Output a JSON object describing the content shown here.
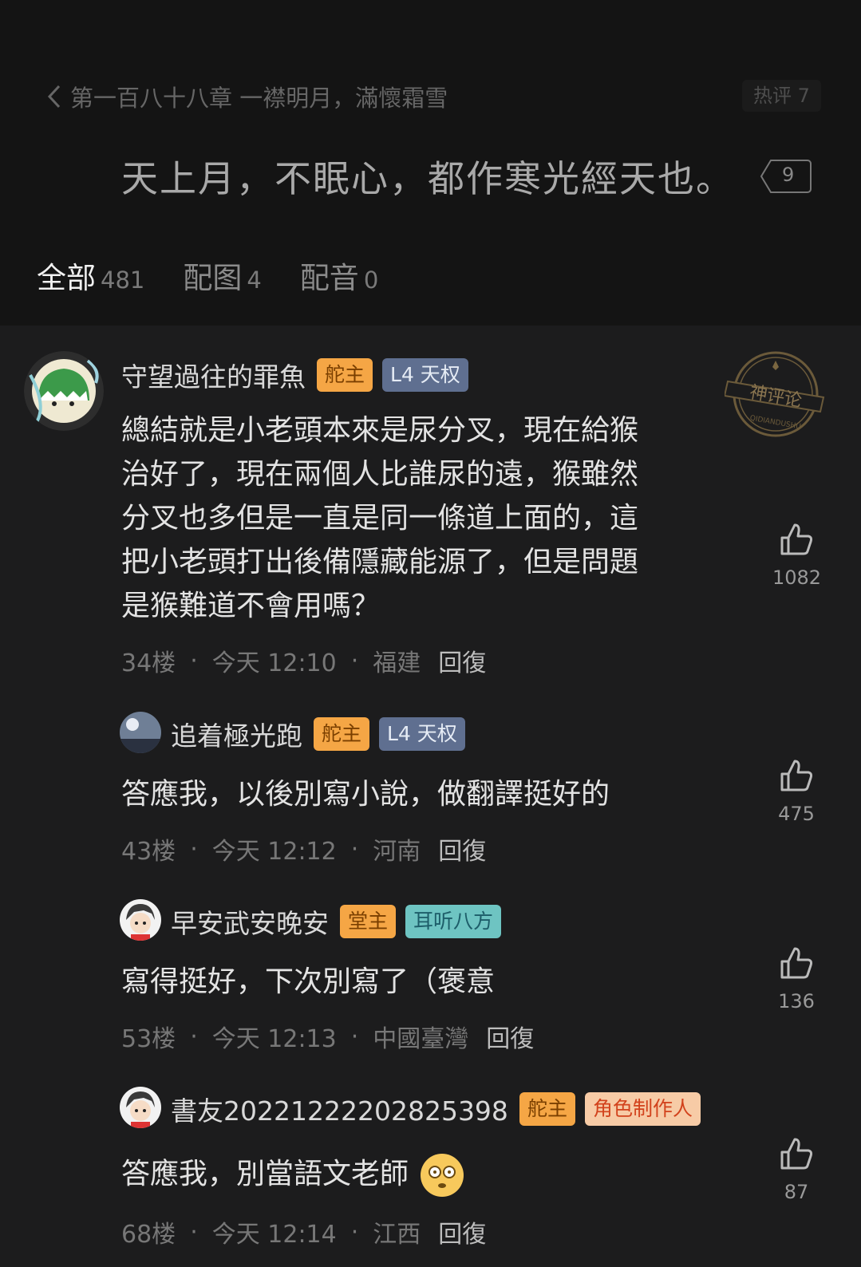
{
  "header": {
    "chapter_title": "第一百八十八章 一襟明月，滿懷霜雪",
    "hot_label": "热评 7",
    "quote": "天上月，不眠心，都作寒光經天也。",
    "quote_count": "9"
  },
  "tabs": [
    {
      "label": "全部",
      "count": "481",
      "active": true
    },
    {
      "label": "配图",
      "count": "4",
      "active": false
    },
    {
      "label": "配音",
      "count": "0",
      "active": false
    }
  ],
  "stamp_text": {
    "main": "神评论",
    "sub": "QIDIANDUSHU"
  },
  "comments": [
    {
      "user": "守望過往的罪魚",
      "badges": [
        "舵主",
        "L4 天权"
      ],
      "lines": [
        "總結就是小老頭本來是尿分叉，現在給猴",
        "治好了，現在兩個人比誰尿的遠，猴雖然",
        "分叉也多但是一直是同一條道上面的，這",
        "把小老頭打出後備隱藏能源了，但是問題",
        "是猴難道不會用嗎？"
      ],
      "floor": "34楼",
      "time": "今天 12:10",
      "location": "福建",
      "reply": "回復",
      "likes": "1082"
    },
    {
      "user": "追着極光跑",
      "badges": [
        "舵主",
        "L4 天权"
      ],
      "lines": [
        "答應我，以後別寫小說，做翻譯挺好的"
      ],
      "floor": "43楼",
      "time": "今天 12:12",
      "location": "河南",
      "reply": "回復",
      "likes": "475"
    },
    {
      "user": "早安武安晚安",
      "badges": [
        "堂主",
        "耳听八方"
      ],
      "lines": [
        "寫得挺好，下次別寫了（褒意"
      ],
      "floor": "53楼",
      "time": "今天 12:13",
      "location": "中國臺灣",
      "reply": "回復",
      "likes": "136"
    },
    {
      "user": "書友20221222202825398",
      "badges": [
        "舵主",
        "角色制作人"
      ],
      "lines": [
        "答應我，別當語文老師"
      ],
      "floor": "68楼",
      "time": "今天 12:14",
      "location": "江西",
      "reply": "回復",
      "likes": "87"
    }
  ],
  "colors": {
    "accent": "#e8323b",
    "badge_orange": "#f5a645",
    "badge_blue": "#5f6f90",
    "badge_green": "#6ec4c2",
    "badge_peach": "#f7cba6"
  }
}
